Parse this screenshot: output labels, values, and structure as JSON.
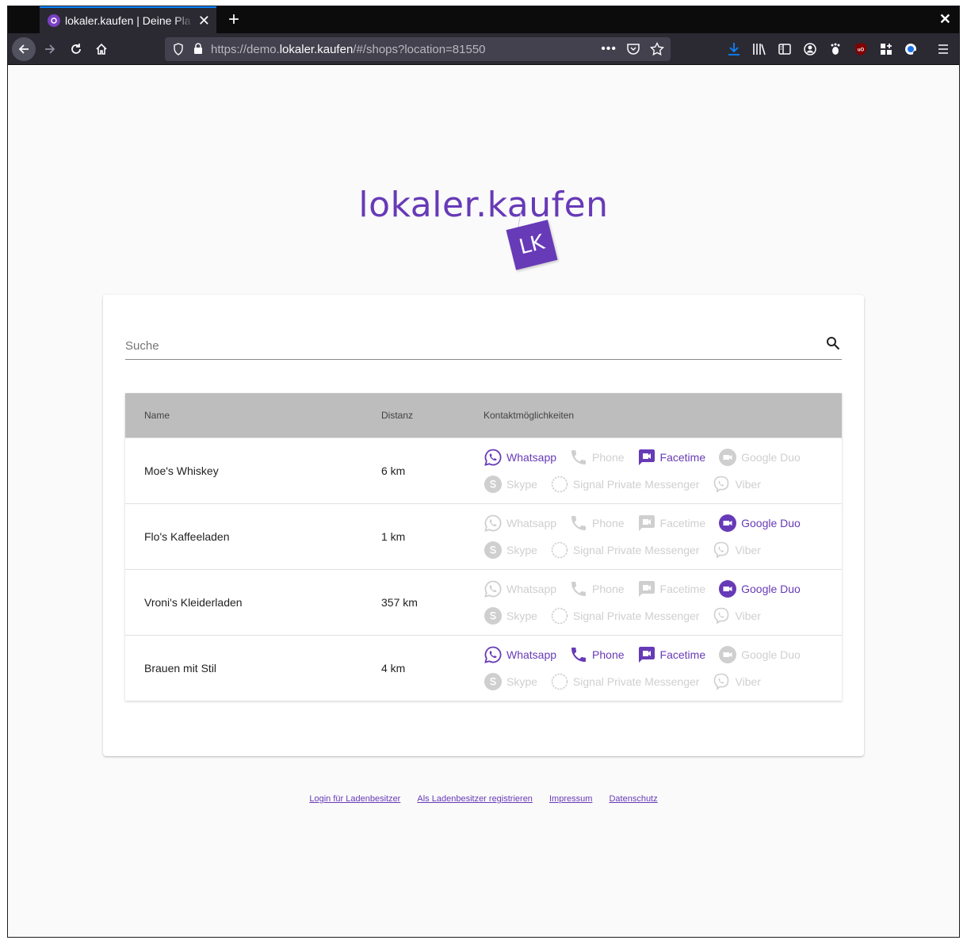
{
  "browser": {
    "tab_title": "lokaler.kaufen | Deine Pla",
    "url_prefix": "https://demo.",
    "url_host": "lokaler.kaufen",
    "url_path": "/#/shops?location=81550"
  },
  "colors": {
    "accent": "#673ab7",
    "disabled": "#cfcfcf",
    "header_bg": "#bdbdbd"
  },
  "logo": {
    "text": "lokaler.kaufen",
    "tag": "LK"
  },
  "search": {
    "placeholder": "Suche"
  },
  "table": {
    "headers": {
      "name": "Name",
      "distance": "Distanz",
      "contact": "Kontaktmöglichkeiten"
    },
    "rows": [
      {
        "name": "Moe's Whiskey",
        "distance": "6 km",
        "contacts": [
          {
            "label": "Whatsapp",
            "icon": "whatsapp-icon",
            "active": true
          },
          {
            "label": "Phone",
            "icon": "phone-icon",
            "active": false
          },
          {
            "label": "Facetime",
            "icon": "facetime-icon",
            "active": true
          },
          {
            "label": "Google Duo",
            "icon": "google-duo-icon",
            "active": false
          },
          {
            "label": "Skype",
            "icon": "skype-icon",
            "active": false
          },
          {
            "label": "Signal Private Messenger",
            "icon": "signal-icon",
            "active": false
          },
          {
            "label": "Viber",
            "icon": "viber-icon",
            "active": false
          }
        ]
      },
      {
        "name": "Flo's Kaffeeladen",
        "distance": "1 km",
        "contacts": [
          {
            "label": "Whatsapp",
            "icon": "whatsapp-icon",
            "active": false
          },
          {
            "label": "Phone",
            "icon": "phone-icon",
            "active": false
          },
          {
            "label": "Facetime",
            "icon": "facetime-icon",
            "active": false
          },
          {
            "label": "Google Duo",
            "icon": "google-duo-icon",
            "active": true
          },
          {
            "label": "Skype",
            "icon": "skype-icon",
            "active": false
          },
          {
            "label": "Signal Private Messenger",
            "icon": "signal-icon",
            "active": false
          },
          {
            "label": "Viber",
            "icon": "viber-icon",
            "active": false
          }
        ]
      },
      {
        "name": "Vroni's Kleiderladen",
        "distance": "357 km",
        "contacts": [
          {
            "label": "Whatsapp",
            "icon": "whatsapp-icon",
            "active": false
          },
          {
            "label": "Phone",
            "icon": "phone-icon",
            "active": false
          },
          {
            "label": "Facetime",
            "icon": "facetime-icon",
            "active": false
          },
          {
            "label": "Google Duo",
            "icon": "google-duo-icon",
            "active": true
          },
          {
            "label": "Skype",
            "icon": "skype-icon",
            "active": false
          },
          {
            "label": "Signal Private Messenger",
            "icon": "signal-icon",
            "active": false
          },
          {
            "label": "Viber",
            "icon": "viber-icon",
            "active": false
          }
        ]
      },
      {
        "name": "Brauen mit Stil",
        "distance": "4 km",
        "contacts": [
          {
            "label": "Whatsapp",
            "icon": "whatsapp-icon",
            "active": true
          },
          {
            "label": "Phone",
            "icon": "phone-icon",
            "active": true
          },
          {
            "label": "Facetime",
            "icon": "facetime-icon",
            "active": true
          },
          {
            "label": "Google Duo",
            "icon": "google-duo-icon",
            "active": false
          },
          {
            "label": "Skype",
            "icon": "skype-icon",
            "active": false
          },
          {
            "label": "Signal Private Messenger",
            "icon": "signal-icon",
            "active": false
          },
          {
            "label": "Viber",
            "icon": "viber-icon",
            "active": false
          }
        ]
      }
    ]
  },
  "footer": {
    "links": [
      "Login für Ladenbesitzer",
      "Als Ladenbesitzer registrieren",
      "Impressum",
      "Datenschutz"
    ]
  }
}
